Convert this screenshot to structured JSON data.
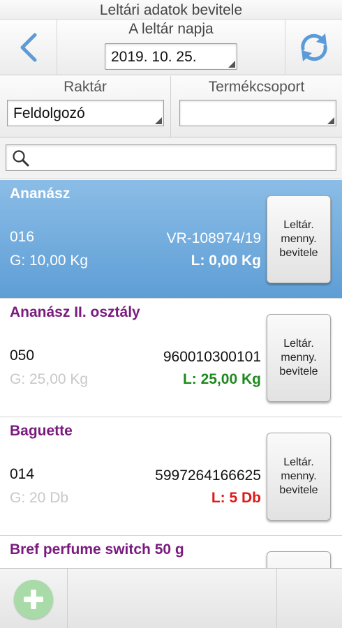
{
  "window": {
    "title": "Leltári adatok bevitele"
  },
  "header": {
    "date_label": "A leltár napja",
    "date_value": "2019. 10. 25.",
    "back_icon": "chevron-left-icon",
    "refresh_icon": "refresh-icon"
  },
  "filters": {
    "warehouse": {
      "label": "Raktár",
      "value": "Feldolgozó"
    },
    "product_group": {
      "label": "Termékcsoport",
      "value": ""
    }
  },
  "search": {
    "placeholder": "",
    "icon": "search-icon"
  },
  "items": [
    {
      "name": "Ananász",
      "code": "016",
      "ref": "VR-108974/19",
      "g": "G: 10,00 Kg",
      "l": "L: 0,00 Kg",
      "l_color": "#ffffff",
      "button": "Leltár.\nmenny.\nbevitele",
      "selected": true
    },
    {
      "name": "Ananász II. osztály",
      "code": "050",
      "ref": "960010300101",
      "g": "G: 25,00 Kg",
      "l": "L: 25,00 Kg",
      "l_color": "#1e8a1e",
      "button": "Leltár.\nmenny.\nbevitele",
      "selected": false
    },
    {
      "name": "Baguette",
      "code": "014",
      "ref": "5997264166625",
      "g": "G: 20 Db",
      "l": "L: 5 Db",
      "l_color": "#e01818",
      "button": "Leltár.\nmenny.\nbevitele",
      "selected": false
    },
    {
      "name": "Bref perfume switch 50 g",
      "code": "",
      "ref": "",
      "g": "",
      "l": "",
      "l_color": "#111111",
      "button": "",
      "selected": false
    }
  ],
  "footer": {
    "add_icon": "plus-circle-icon"
  },
  "colors": {
    "accent": "#5e9ed6",
    "item_name": "#7a1a7e",
    "add_button": "#a8dba8"
  }
}
